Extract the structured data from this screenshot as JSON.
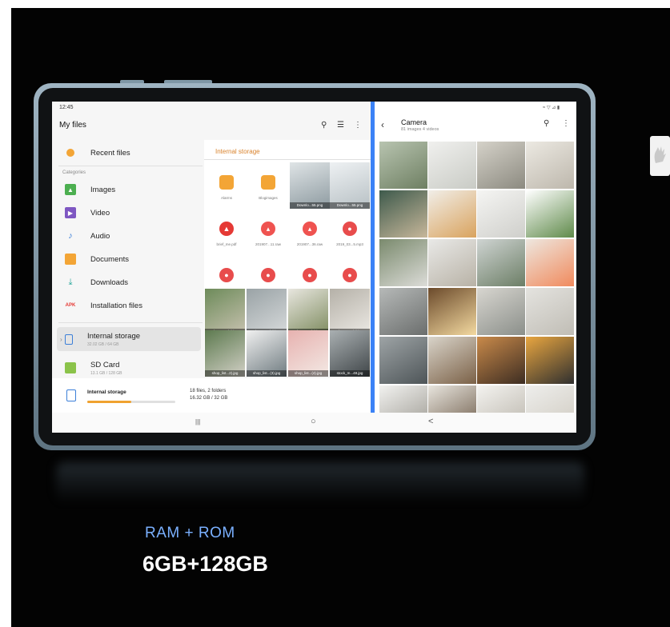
{
  "status": {
    "time": "12:45",
    "right_icons": "≈ ▽ ⊿ ▮"
  },
  "files": {
    "title": "My files",
    "toolbar_icons": [
      "search-icon",
      "list-view-icon",
      "more-options-icon"
    ],
    "recent": "Recent files",
    "categories_label": "Categories",
    "categories": [
      "Images",
      "Video",
      "Audio",
      "Documents",
      "Downloads",
      "Installation files"
    ],
    "apk_badge": "APK",
    "storage": [
      {
        "name": "Internal storage",
        "detail": "32.02 GB / 64 GB"
      },
      {
        "name": "SD Card",
        "detail": "13.1 GB / 128 GB"
      }
    ],
    "panel_title": "Internal storage",
    "grid_captions": [
      "Alarms",
      "Blogimages",
      "Downlo...55.png",
      "Downlo...55.png",
      "brief_me.pdf",
      "201907...11.raw",
      "201907...36.raw",
      "2019_03...5.mp3",
      "2019_03...2.mp3",
      "2019_03...8.mp3",
      "2019_04...3.mp3",
      "2019_06...3.mp3",
      "photo_0...(3).jpg",
      "photo_0...(9).jpg",
      "photo_2...(3).jpg",
      "photo_4...(9).jpg",
      "shop_list...2).jpg",
      "shop_list...(3).jpg",
      "shop_list...(4).jpg",
      "stock_m...48.jpg"
    ],
    "footer": {
      "name": "Internal storage",
      "files": "18 files, 2 folders",
      "size": "16.32 GB / 32 GB",
      "fill": 0.5
    }
  },
  "camera": {
    "title": "Camera",
    "subtitle": "81 images 4 videos"
  },
  "navbar": {
    "recents": "|||",
    "home": "○",
    "back": "<"
  },
  "spec": {
    "label": "RAM + ROM",
    "value": "6GB+128GB"
  },
  "colors": {
    "accent": "#3b82f6",
    "folder": "#f3a536",
    "spec_label": "#7ab0ff"
  }
}
